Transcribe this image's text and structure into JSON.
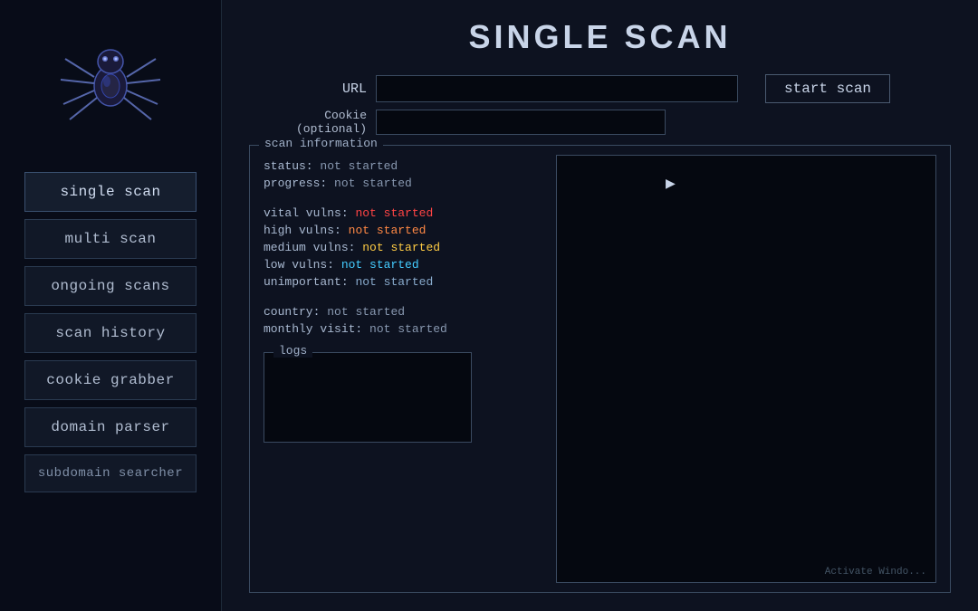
{
  "page": {
    "title": "SINGLE SCAN"
  },
  "sidebar": {
    "nav_items": [
      {
        "id": "single-scan",
        "label": "single scan",
        "active": true
      },
      {
        "id": "multi-scan",
        "label": "multi scan",
        "active": false
      },
      {
        "id": "ongoing-scans",
        "label": "ongoing scans",
        "active": false
      },
      {
        "id": "scan-history",
        "label": "scan history",
        "active": false
      },
      {
        "id": "cookie-grabber",
        "label": "cookie grabber",
        "active": false
      },
      {
        "id": "domain-parser",
        "label": "domain parser",
        "active": false
      },
      {
        "id": "subdomain-searcher",
        "label": "subdomain searcher",
        "active": false
      }
    ]
  },
  "form": {
    "url_label": "URL",
    "url_placeholder": "",
    "cookie_label": "Cookie (optional)",
    "cookie_placeholder": "",
    "start_scan_label": "start scan"
  },
  "scan_info": {
    "panel_label": "scan information",
    "status_label": "status:",
    "status_value": "not started",
    "progress_label": "progress:",
    "progress_value": "not started",
    "vital_label": "vital vulns:",
    "vital_value": "not started",
    "high_label": "high vulns:",
    "high_value": "not started",
    "medium_label": "medium vulns:",
    "medium_value": "not started",
    "low_label": "low vulns:",
    "low_value": "not started",
    "unimportant_label": "unimportant:",
    "unimportant_value": "not started",
    "country_label": "country:",
    "country_value": "not started",
    "monthly_label": "monthly visit:",
    "monthly_value": "not started"
  },
  "logs": {
    "panel_label": "logs"
  },
  "watermark": {
    "text": "Activate Windo..."
  }
}
